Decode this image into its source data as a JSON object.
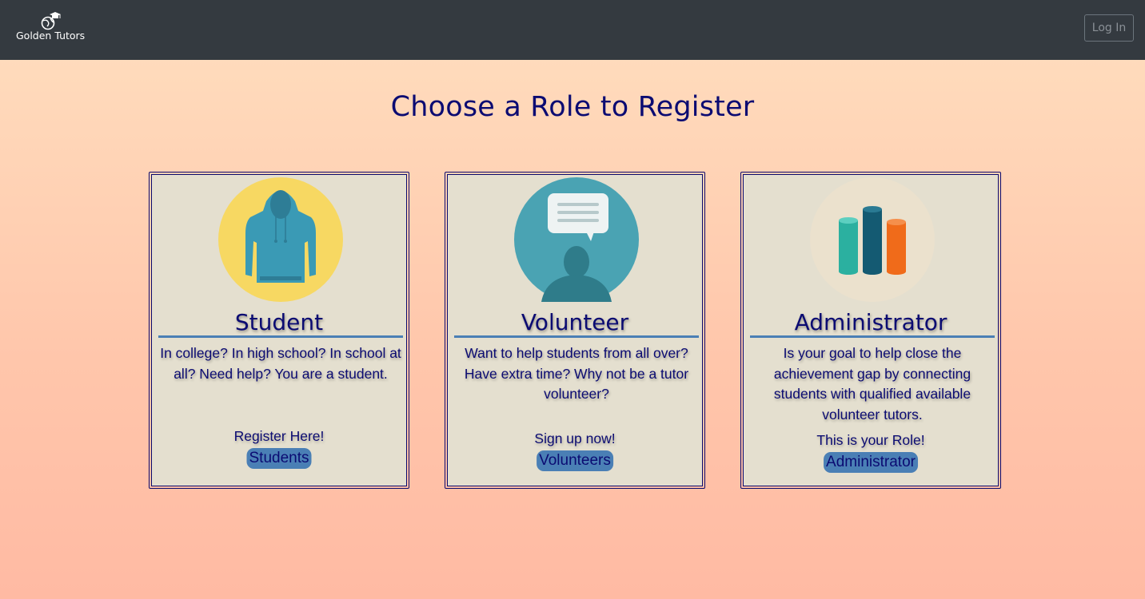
{
  "navbar": {
    "brand_name": "Golden Tutors",
    "login_label": "Log In"
  },
  "main": {
    "title": "Choose a Role to Register"
  },
  "cards": [
    {
      "title": "Student",
      "icon": "hoodie-icon",
      "description": "In college? In high school? In school at all? Need help? You are a student.",
      "cta": "Register Here!",
      "button": "Students"
    },
    {
      "title": "Volunteer",
      "icon": "speech-bubble-person-icon",
      "description": "Want to help students from all over? Have extra time? Why not be a tutor volunteer?",
      "cta": "Sign up now!",
      "button": "Volunteers"
    },
    {
      "title": "Administrator",
      "icon": "bar-chart-cylinders-icon",
      "description": "Is your goal to help close the achievement gap by connecting students with qualified available volunteer tutors.",
      "cta": "This is your Role!",
      "button": "Administrator"
    }
  ],
  "colors": {
    "navbar_bg": "#343a40",
    "heading": "#0b0b72",
    "accent": "#4a7fb5",
    "card_bg": "#e4dfcf"
  }
}
